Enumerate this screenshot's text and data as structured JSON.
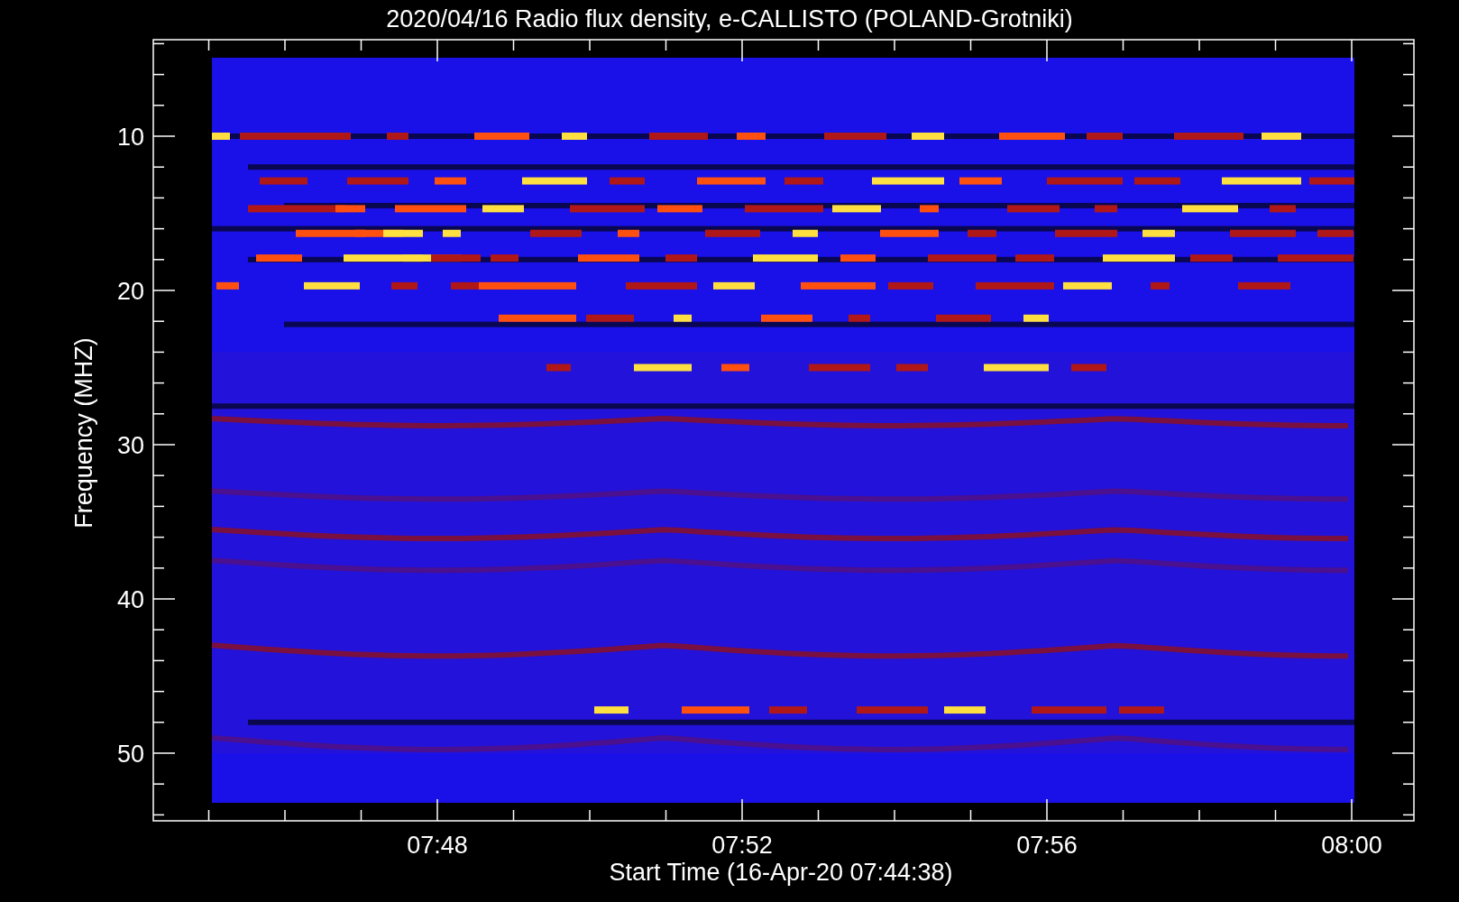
{
  "title": "2020/04/16  Radio flux density, e-CALLISTO (POLAND-Grotniki)",
  "y_axis": {
    "label": "Frequency (MHZ)",
    "ticks": [
      "10",
      "20",
      "30",
      "40",
      "50"
    ]
  },
  "x_axis": {
    "label": "Start Time (16-Apr-20 07:44:38)",
    "ticks": [
      "07:48",
      "07:52",
      "07:56",
      "08:00"
    ]
  }
}
